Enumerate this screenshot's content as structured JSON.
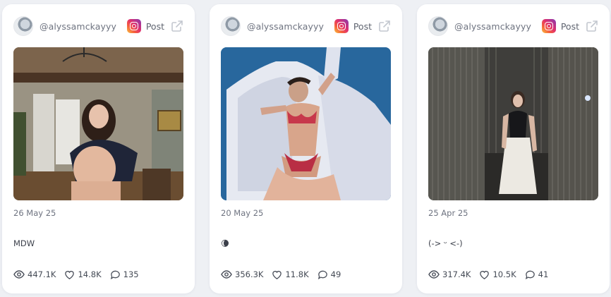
{
  "posts": [
    {
      "handle": "@alyssamckayyy",
      "platform_label": "Post",
      "date": "26 May 25",
      "caption": "MDW",
      "views": "447.1K",
      "likes": "14.8K",
      "comments": "135"
    },
    {
      "handle": "@alyssamckayyy",
      "platform_label": "Post",
      "date": "20 May 25",
      "caption": "🌘",
      "views": "356.3K",
      "likes": "11.8K",
      "comments": "49"
    },
    {
      "handle": "@alyssamckayyy",
      "platform_label": "Post",
      "date": "25 Apr 25",
      "caption": "(-> ᵕ <-)",
      "views": "317.4K",
      "likes": "10.5K",
      "comments": "41"
    }
  ],
  "icons": {
    "platform": "instagram-icon",
    "open": "external-link-icon",
    "views": "eye-icon",
    "likes": "heart-icon",
    "comments": "comment-icon"
  },
  "colors": {
    "page_bg": "#eef0f4",
    "card_bg": "#ffffff",
    "muted_text": "#6e7380"
  }
}
